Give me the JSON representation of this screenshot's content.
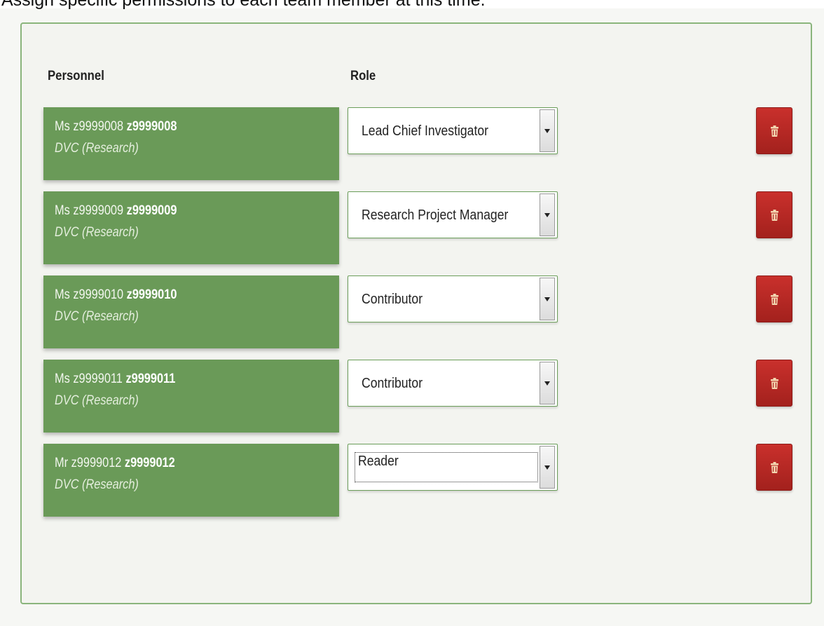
{
  "instruction": "Assign specific permissions to each team member at this time.",
  "headers": {
    "personnel": "Personnel",
    "role": "Role"
  },
  "colors": {
    "card_green": "#6a9a58",
    "panel_border": "#8ab57c",
    "delete_red": "#c9302c"
  },
  "rows": [
    {
      "title": "Ms",
      "name": "z9999008",
      "username": "z9999008",
      "department": "DVC (Research)",
      "role": "Lead Chief Investigator",
      "delete_icon": "trash-icon"
    },
    {
      "title": "Ms",
      "name": "z9999009",
      "username": "z9999009",
      "department": "DVC (Research)",
      "role": "Research Project Manager",
      "delete_icon": "trash-icon"
    },
    {
      "title": "Ms",
      "name": "z9999010",
      "username": "z9999010",
      "department": "DVC (Research)",
      "role": "Contributor",
      "delete_icon": "trash-icon"
    },
    {
      "title": "Ms",
      "name": "z9999011",
      "username": "z9999011",
      "department": "DVC (Research)",
      "role": "Contributor",
      "delete_icon": "trash-icon"
    },
    {
      "title": "Mr",
      "name": "z9999012",
      "username": "z9999012",
      "department": "DVC (Research)",
      "role": "Reader",
      "delete_icon": "trash-icon"
    }
  ]
}
